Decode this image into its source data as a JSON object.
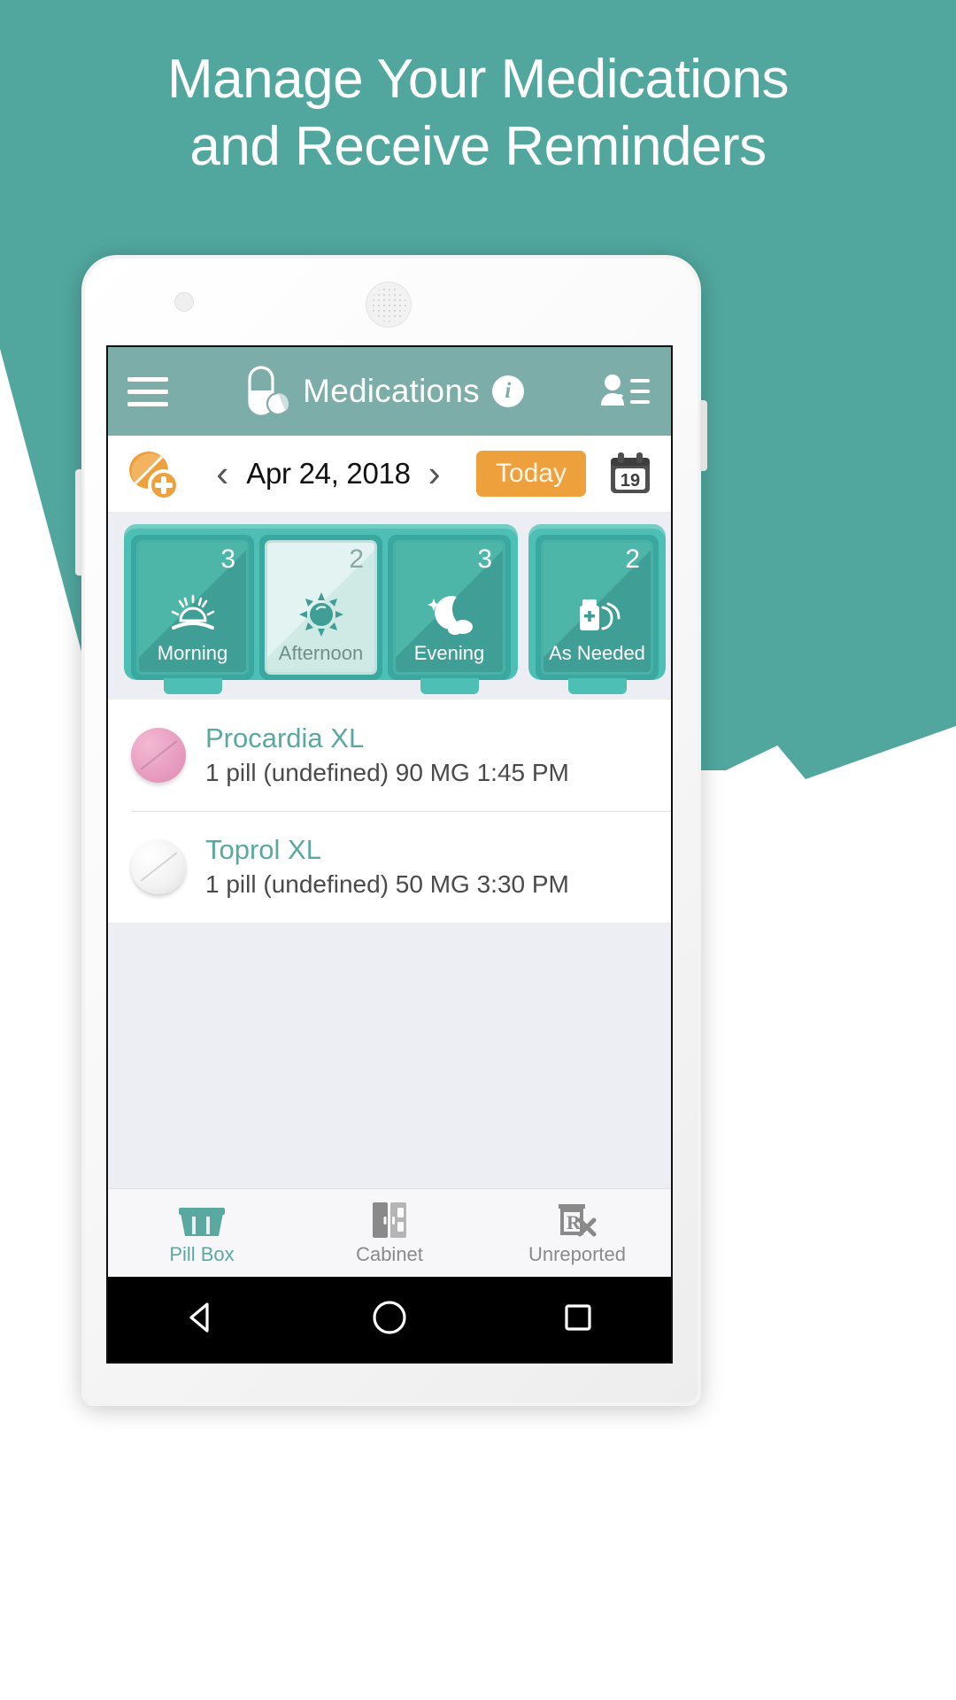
{
  "promo": {
    "line1": "Manage Your Medications",
    "line2": "and Receive Reminders",
    "bg_color": "#51a79e"
  },
  "appbar": {
    "menu_icon": "hamburger-menu-icon",
    "brand_icon": "capsule-pill-icon",
    "title": "Medications",
    "info_icon": "info-icon",
    "contacts_icon": "contacts-list-icon",
    "bg_color": "#7cada8"
  },
  "datebar": {
    "add_icon": "add-medication-icon",
    "prev_label": "‹",
    "date": "Apr 24, 2018",
    "next_label": "›",
    "today_label": "Today",
    "today_color": "#eda03c",
    "calendar_icon": "calendar-icon",
    "calendar_day": "19"
  },
  "pillbox": {
    "tray_color": "#4ebfb4",
    "compartments": [
      {
        "label": "Morning",
        "count": "3",
        "icon": "sunrise-icon",
        "open": false
      },
      {
        "label": "Afternoon",
        "count": "2",
        "icon": "sun-icon",
        "open": true
      },
      {
        "label": "Evening",
        "count": "3",
        "icon": "moon-icon",
        "open": false
      },
      {
        "label": "As Needed",
        "count": "2",
        "icon": "pill-bottle-icon",
        "open": false
      }
    ]
  },
  "medications": [
    {
      "name": "Procardia XL",
      "details": "1 pill (undefined) 90 MG 1:45 PM",
      "pill_color": "#e79cc0",
      "pill_style": "pink"
    },
    {
      "name": "Toprol XL",
      "details": "1 pill (undefined) 50 MG 3:30 PM",
      "pill_color": "#f2f2f2",
      "pill_style": "white"
    }
  ],
  "tabbar": {
    "items": [
      {
        "label": "Pill Box",
        "icon": "pillbox-tray-icon",
        "active": true
      },
      {
        "label": "Cabinet",
        "icon": "cabinet-icon",
        "active": false
      },
      {
        "label": "Unreported",
        "icon": "unreported-rx-icon",
        "active": false
      }
    ],
    "active_color": "#5aa9a1"
  },
  "androidnav": {
    "back": "back-triangle-icon",
    "home": "home-circle-icon",
    "recent": "recents-square-icon"
  }
}
